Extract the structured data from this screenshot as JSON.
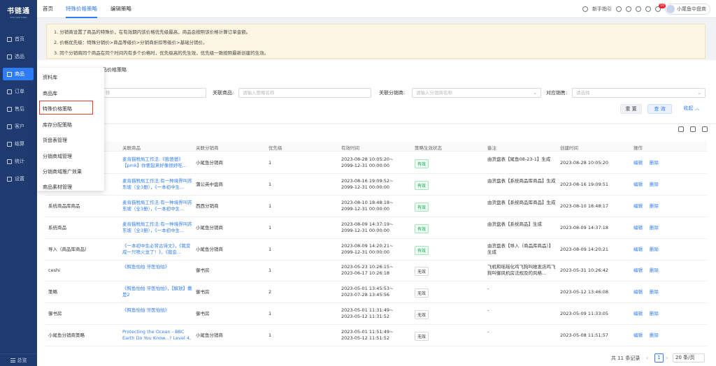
{
  "app": {
    "logo": "书链通",
    "logo_sub": "SHU LIAN TONG"
  },
  "sidebar": {
    "items": [
      {
        "label": "首页",
        "icon": "home-icon"
      },
      {
        "label": "选品",
        "icon": "select-icon"
      },
      {
        "label": "商品",
        "icon": "goods-icon",
        "active": true
      },
      {
        "label": "订单",
        "icon": "order-icon"
      },
      {
        "label": "售后",
        "icon": "aftersale-icon"
      },
      {
        "label": "客户",
        "icon": "customer-icon"
      },
      {
        "label": "结算",
        "icon": "settle-icon"
      },
      {
        "label": "统计",
        "icon": "stats-icon"
      },
      {
        "label": "设置",
        "icon": "settings-icon"
      }
    ],
    "collapse_label": "总览"
  },
  "topbar": {
    "tabs": [
      "首页",
      "特殊价格策略",
      "编辑策略"
    ],
    "guide": "新手指引",
    "notification_count": "10",
    "user": "小尾鱼中盘商"
  },
  "notice": [
    "1. 分销商设置了商品的特殊价，在有效期内该价格优先级最高，商品会按照该价格计算订单金额。",
    "2. 价格优先级：特殊分销价>商品等级价>分销商折扣等级价>基础分销价。",
    "3. 同个分销商同个商品在同个时间内有多个价格时，优先级高的先生效，优先级一致按照最新创建的生效。"
  ],
  "filters": {
    "title": "品价格策略",
    "name_placeholder": "称",
    "goods_label": "关联商品:",
    "goods_placeholder": "请输入策略名称",
    "distributor_label": "关联分销商:",
    "distributor_placeholder": "请输入分销商名称",
    "sales_label": "对应销售:",
    "sales_placeholder": "请选择",
    "reset": "重 置",
    "query": "查 询",
    "fold": "收起 ︿"
  },
  "dropdown": {
    "items": [
      "资料库",
      "商品库",
      "特殊价格策略",
      "库存分配策略",
      "货盘表管理",
      "分销商域管理",
      "分销商域推广效果",
      "商品素材管理"
    ]
  },
  "table": {
    "headers": [
      "关联商品",
      "关联分销商",
      "优先级",
      "有效时间",
      "策略生效状态",
      "备注",
      "创建时间",
      "操作"
    ],
    "edit_label": "编辑",
    "delete_label": "删除",
    "rows": [
      {
        "name": "",
        "goods": "麦肯猫税局工作法:《我爸爸》【pmk】你要起来好像很好吃...",
        "distributor": "小尾鱼分销商",
        "priority": "1",
        "time": "2023-08-28 10:05:20~\n2099-12-31 00:00:00",
        "status": "有效",
        "remark": "由货盘表【尾鱼08-23-1】生成",
        "created": "2023-08-28 10:05:20"
      },
      {
        "name": "",
        "goods": "麦肯猫税局工作法:有一种境界叫苏东坡（全3册），《一本初中生...",
        "distributor": "蒲公英中盘商",
        "priority": "1",
        "time": "2023-08-16 19:09:52~\n2099-12-31 00:00:00",
        "status": "有效",
        "remark": "由货盘表【系统商品库商品】生成",
        "created": "2023-08-16 19:09:51"
      },
      {
        "name": "系统商品库商品",
        "goods": "麦肯猫税局工作法:有一种境界叫苏东坡（全3册），《一本初中生...",
        "distributor": "西西分销商",
        "priority": "1",
        "time": "2023-08-10 18:48:18~\n2099-12-31 00:00:00",
        "status": "有效",
        "remark": "由货盘表【系统商品库商品】生成",
        "created": "2023-08-10 18:48:17"
      },
      {
        "name": "系统商品",
        "goods": "麦肯猫税局工作法:有一种境界叫苏东坡（全3册），《一本初中生...",
        "distributor": "小尾鱼分销商",
        "priority": "1",
        "time": "2023-08-09 14:37:19~\n2099-12-31 00:00:00",
        "status": "有效",
        "remark": "由货盘表【系统商品】生成",
        "created": "2023-08-09 14:37:18"
      },
      {
        "name": "导入（商品库商品）",
        "goods": "《一本初中生必背古诗文》，《我变成一只喷火龙了！》，《我会...",
        "distributor": "小尾鱼分销商",
        "priority": "1",
        "time": "2023-08-09 14:20:21~\n2099-12-31 00:00:00",
        "status": "有效",
        "remark": "由货盘表【导入（商品库商品）】生成",
        "created": "2023-08-09 14:20:21"
      },
      {
        "name": "ceshi",
        "goods": "《鳄鱼怕怕 牙医怕怕》",
        "distributor": "御书房",
        "priority": "1",
        "time": "2023-05-23 10:26:15~\n2023-06-17 10:26:18",
        "status": "无效",
        "remark": "飞机和瑶瑶化鸡飞狗叫她发店鸡飞狗叫御风机房法规及的风格...",
        "created": "2023-05-31 10:26:42"
      },
      {
        "name": "策略",
        "goods": "《鳄鱼怕怕 牙医怕怕》，【解放】撒是2",
        "distributor": "御书房",
        "priority": "2",
        "time": "2023-05-01 13:45:53~\n2023-07-28 13:45:56",
        "status": "无效",
        "remark": "-",
        "created": "2023-05-12 13:46:08"
      },
      {
        "name": "御书房",
        "goods": "《鳄鱼怕怕 牙医怕怕》",
        "distributor": "御书房",
        "priority": "1",
        "time": "2023-05-01 11:31:49~\n2023-05-12 11:31:52",
        "status": "无效",
        "remark": "-",
        "created": "2023-05-09 11:33:05"
      },
      {
        "name": "小尾鱼分销商策略",
        "goods": "Protecting the Ocean - BBC Earth Do You Know...? Level 4,国家...",
        "distributor": "小尾鱼分销商",
        "priority": "1",
        "time": "2023-05-01 11:51:49~\n2023-05-12 11:51:52",
        "status": "无效",
        "remark": "-",
        "created": "2023-05-08 11:51:57"
      }
    ]
  },
  "pager": {
    "total": "共 11 条记录",
    "page": "1",
    "size": "20 条/页"
  }
}
